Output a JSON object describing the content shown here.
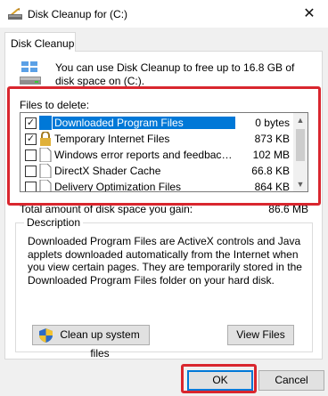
{
  "window": {
    "title": "Disk Cleanup for  (C:)",
    "close_glyph": "✕"
  },
  "tab": {
    "label": "Disk Cleanup"
  },
  "intro": {
    "text": "You can use Disk Cleanup to free up to 16.8 GB of disk space on  (C:)."
  },
  "files": {
    "label": "Files to delete:",
    "items": [
      {
        "name": "Downloaded Program Files",
        "size": "0 bytes",
        "checked": true,
        "selected": true
      },
      {
        "name": "Temporary Internet Files",
        "size": "873 KB",
        "checked": true,
        "selected": false
      },
      {
        "name": "Windows error reports and feedback di...",
        "size": "102 MB",
        "checked": false,
        "selected": false
      },
      {
        "name": "DirectX Shader Cache",
        "size": "66.8 KB",
        "checked": false,
        "selected": false
      },
      {
        "name": "Delivery Optimization Files",
        "size": "864 KB",
        "checked": false,
        "selected": false
      }
    ],
    "check_glyph": "✓"
  },
  "total": {
    "label": "Total amount of disk space you gain:",
    "value": "86.6 MB"
  },
  "description": {
    "legend": "Description",
    "text": "Downloaded Program Files are ActiveX controls and Java applets downloaded automatically from the Internet when you view certain pages. They are temporarily stored in the Downloaded Program Files folder on your hard disk."
  },
  "buttons": {
    "cleanup_system": "Clean up system files",
    "view_files": "View Files",
    "ok": "OK",
    "cancel": "Cancel"
  },
  "colors": {
    "selection": "#0078d7",
    "highlight": "#d9262e"
  }
}
